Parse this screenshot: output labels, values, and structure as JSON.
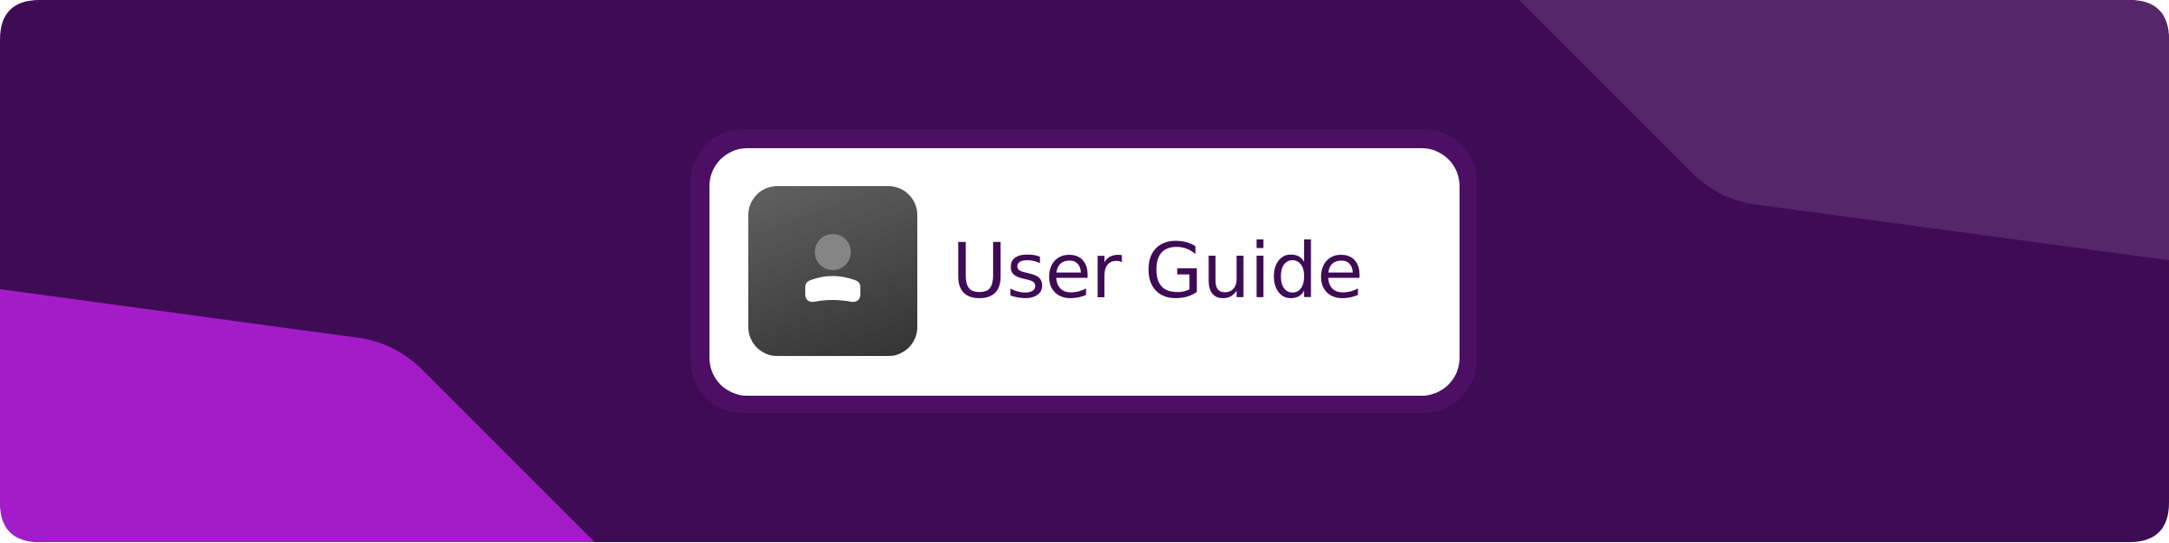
{
  "banner": {
    "title": "User Guide",
    "icon": "user-icon"
  },
  "colors": {
    "background": "#3e0b55",
    "corner_accent": "#56266a",
    "side_accent": "#a41cc9",
    "card_border": "#4c0f63",
    "card": "#ffffff",
    "title_text": "#3e0b55",
    "tile_gradient_start": "#616161",
    "tile_gradient_end": "#333333"
  }
}
